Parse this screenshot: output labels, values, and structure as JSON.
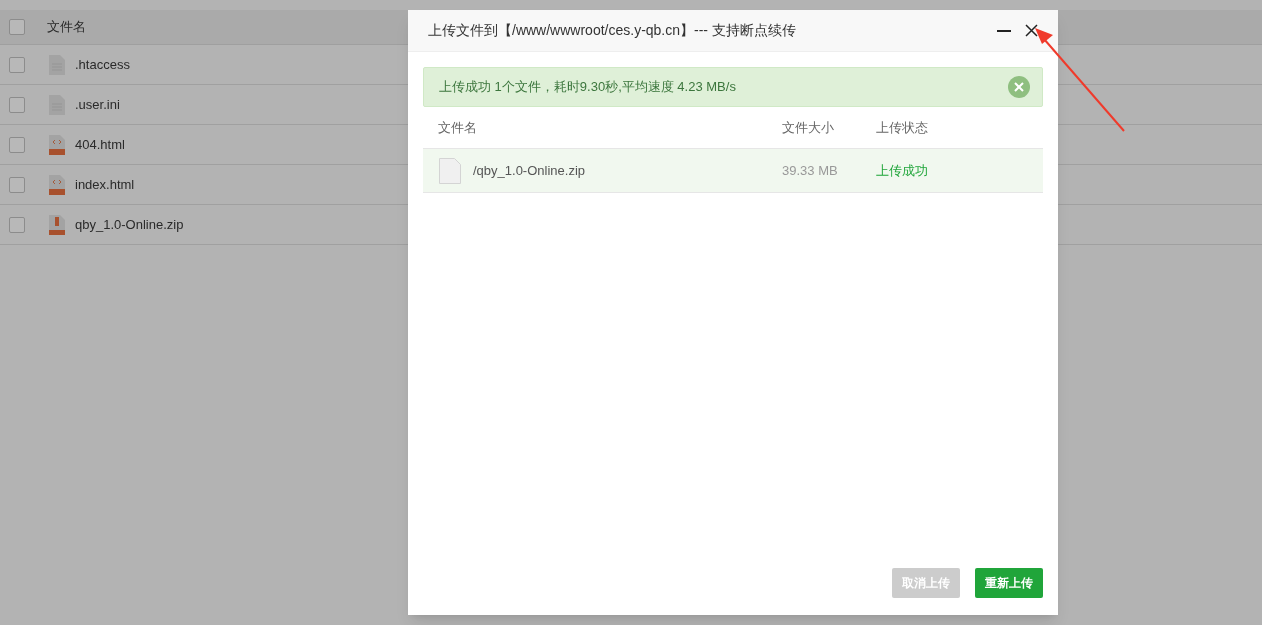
{
  "file_list": {
    "header": {
      "label": "文件名",
      "checked": false
    },
    "rows": [
      {
        "name": ".htaccess",
        "kind": "text",
        "checked": false
      },
      {
        "name": ".user.ini",
        "kind": "text",
        "checked": false
      },
      {
        "name": "404.html",
        "kind": "html",
        "checked": false
      },
      {
        "name": "index.html",
        "kind": "html",
        "checked": false
      },
      {
        "name": "qby_1.0-Online.zip",
        "kind": "zip",
        "checked": false
      }
    ]
  },
  "dialog": {
    "title": "上传文件到【/www/wwwroot/ces.y-qb.cn】--- 支持断点续传",
    "alert": "上传成功 1个文件，耗时9.30秒,平均速度 4.23 MB/s",
    "columns": [
      "文件名",
      "文件大小",
      "上传状态"
    ],
    "rows": [
      {
        "name": "/qby_1.0-Online.zip",
        "size": "39.33 MB",
        "status": "上传成功"
      }
    ],
    "buttons": [
      {
        "label": "取消上传",
        "disabled": true
      },
      {
        "label": "重新上传",
        "disabled": false
      }
    ]
  }
}
